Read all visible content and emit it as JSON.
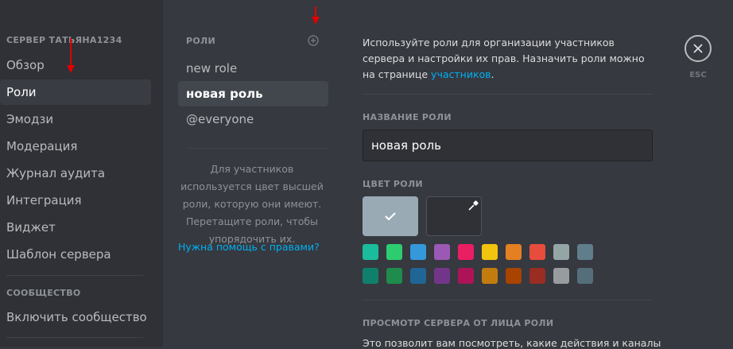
{
  "sidebar": {
    "server_header": "СЕРВЕР ТАТЬЯНА1234",
    "items": [
      {
        "label": "Обзор",
        "active": false
      },
      {
        "label": "Роли",
        "active": true
      },
      {
        "label": "Эмодзи",
        "active": false
      },
      {
        "label": "Модерация",
        "active": false
      },
      {
        "label": "Журнал аудита",
        "active": false
      },
      {
        "label": "Интеграция",
        "active": false
      },
      {
        "label": "Виджет",
        "active": false
      },
      {
        "label": "Шаблон сервера",
        "active": false
      }
    ],
    "community_header": "СООБЩЕСТВО",
    "community_items": [
      {
        "label": "Включить сообщество"
      }
    ]
  },
  "roles": {
    "header": "РОЛИ",
    "add_icon": "plus-circle-icon",
    "items": [
      {
        "label": "new role",
        "active": false
      },
      {
        "label": "новая роль",
        "active": true
      },
      {
        "label": "@everyone",
        "active": false
      }
    ],
    "description": "Для участников используется цвет высшей роли, которую они имеют. Перетащите роли, чтобы упорядочить их.",
    "help_link": "Нужна помощь с правами?"
  },
  "main": {
    "intro_text": "Используйте роли для организации участников сервера и настройки их прав. Назначить роли можно на странице",
    "intro_link": "участников",
    "intro_end": ".",
    "role_name_label": "НАЗВАНИЕ РОЛИ",
    "role_name_value": "новая роль",
    "role_color_label": "ЦВЕТ РОЛИ",
    "default_color": "#99aab5",
    "swatches_row1": [
      "#1abc9c",
      "#2ecc71",
      "#3498db",
      "#9b59b6",
      "#e91e63",
      "#f1c40f",
      "#e67e22",
      "#e74c3c",
      "#95a5a6",
      "#607d8b"
    ],
    "swatches_row2": [
      "#11806a",
      "#1f8b4c",
      "#206694",
      "#71368a",
      "#ad1457",
      "#c27c0e",
      "#a84300",
      "#992d22",
      "#979c9f",
      "#546e7a"
    ],
    "preview_label": "ПРОСМОТР СЕРВЕРА ОТ ЛИЦА РОЛИ",
    "preview_text": "Это позволит вам посмотреть, какие действия и каналы"
  },
  "close": {
    "esc_label": "ESC"
  },
  "colors": {
    "accent_link": "#00b0f4",
    "annotation_arrow": "#e00000"
  }
}
